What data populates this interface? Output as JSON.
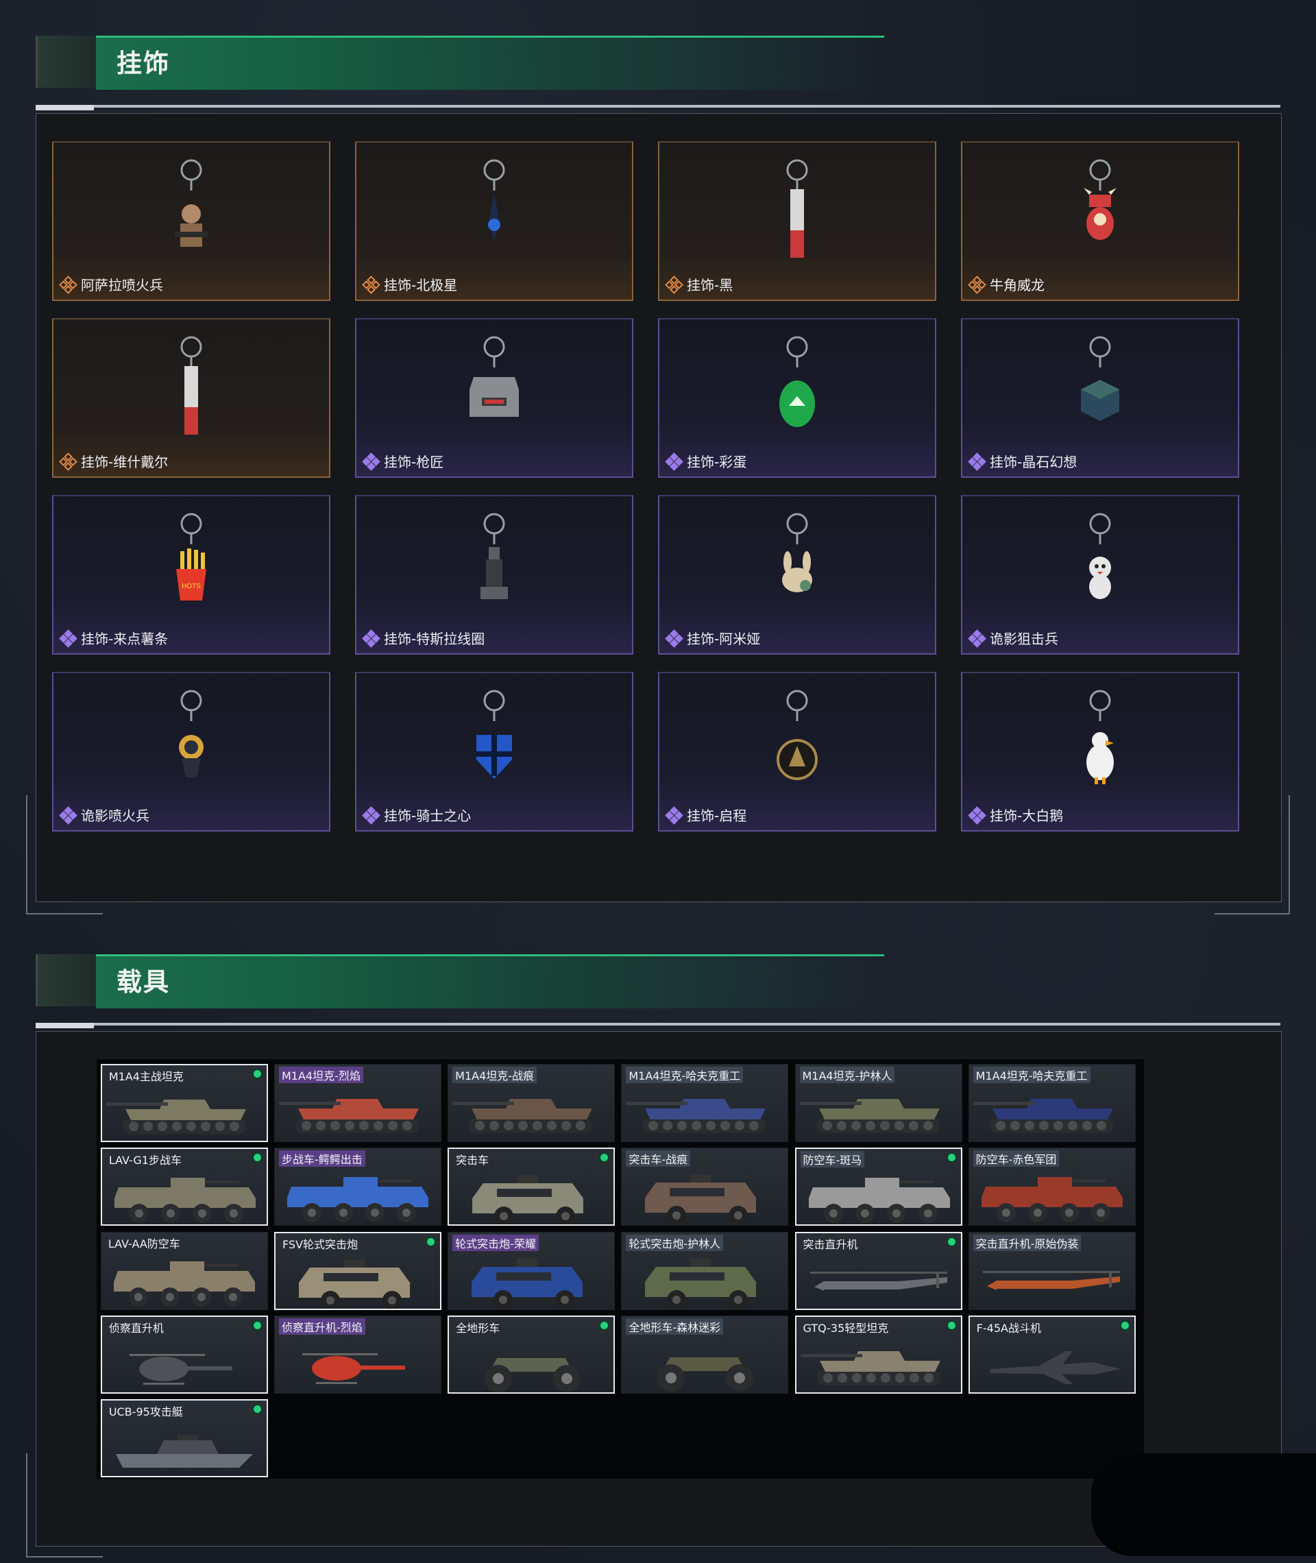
{
  "sections": {
    "charms": {
      "title": "挂饰"
    },
    "vehicles": {
      "title": "载具"
    }
  },
  "charms": [
    {
      "label": "阿萨拉喷火兵",
      "rarity": "gold",
      "icon": "soldier-charm-icon",
      "color": "#8a6a4a"
    },
    {
      "label": "挂饰-北极星",
      "rarity": "gold",
      "icon": "north-star-charm-icon",
      "color": "#2b6ad8"
    },
    {
      "label": "挂饰-黑",
      "rarity": "gold",
      "icon": "blade-charm-icon",
      "color": "#c93a3a"
    },
    {
      "label": "牛角威龙",
      "rarity": "gold",
      "icon": "horn-dragon-charm-icon",
      "color": "#d23d3d"
    },
    {
      "label": "挂饰-维什戴尔",
      "rarity": "gold",
      "icon": "blade-charm-icon",
      "color": "#c93a3a"
    },
    {
      "label": "挂饰-枪匠",
      "rarity": "purple",
      "icon": "gunsmith-case-charm-icon",
      "color": "#8a8c90"
    },
    {
      "label": "挂饰-彩蛋",
      "rarity": "purple",
      "icon": "egg-charm-icon",
      "color": "#1ea84a"
    },
    {
      "label": "挂饰-晶石幻想",
      "rarity": "purple",
      "icon": "crystal-cube-charm-icon",
      "color": "#2c4a5e"
    },
    {
      "label": "挂饰-来点薯条",
      "rarity": "purple",
      "icon": "fries-charm-icon",
      "color": "#e53a2a"
    },
    {
      "label": "挂饰-特斯拉线圈",
      "rarity": "purple",
      "icon": "tesla-coil-charm-icon",
      "color": "#5b5e63"
    },
    {
      "label": "挂饰-阿米娅",
      "rarity": "purple",
      "icon": "bunny-charm-icon",
      "color": "#d9c9a8"
    },
    {
      "label": "诡影狙击兵",
      "rarity": "purple",
      "icon": "sniper-charm-icon",
      "color": "#e6e6e6"
    },
    {
      "label": "诡影喷火兵",
      "rarity": "purple",
      "icon": "flamer-charm-icon",
      "color": "#d8a43a"
    },
    {
      "label": "挂饰-骑士之心",
      "rarity": "purple",
      "icon": "knight-heart-charm-icon",
      "color": "#2457c8"
    },
    {
      "label": "挂饰-启程",
      "rarity": "purple",
      "icon": "medal-charm-icon",
      "color": "#a88a4a"
    },
    {
      "label": "挂饰-大白鹅",
      "rarity": "purple",
      "icon": "goose-charm-icon",
      "color": "#f0f0f0"
    }
  ],
  "vehicles": [
    {
      "label": "M1A4主战坦克",
      "tag": "none",
      "owned": true,
      "type": "tank",
      "color": "#7d7a62"
    },
    {
      "label": "M1A4坦克-烈焰",
      "tag": "purple",
      "owned": false,
      "type": "tank",
      "color": "#b24a3a"
    },
    {
      "label": "M1A4坦克-战痕",
      "tag": "gray",
      "owned": false,
      "type": "tank",
      "color": "#6a5648"
    },
    {
      "label": "M1A4坦克-哈夫克重工",
      "tag": "gray",
      "owned": false,
      "type": "tank",
      "color": "#3a4a8a"
    },
    {
      "label": "M1A4坦克-护林人",
      "tag": "gray",
      "owned": false,
      "type": "tank",
      "color": "#6a6e52"
    },
    {
      "label": "M1A4坦克-哈夫克重工",
      "tag": "gray",
      "owned": false,
      "type": "tank",
      "color": "#2c3a7a"
    },
    {
      "label": "LAV-G1步战车",
      "tag": "none",
      "owned": true,
      "type": "ifv",
      "color": "#7c7a66"
    },
    {
      "label": "步战车-鳄鳄出击",
      "tag": "purple",
      "owned": false,
      "type": "ifv",
      "color": "#3a6ac8"
    },
    {
      "label": "突击车",
      "tag": "none",
      "owned": true,
      "type": "mrap",
      "color": "#8a8a78"
    },
    {
      "label": "突击车-战痕",
      "tag": "gray",
      "owned": false,
      "type": "mrap",
      "color": "#6e5a4e"
    },
    {
      "label": "防空车-斑马",
      "tag": "gray",
      "owned": true,
      "type": "ifv",
      "color": "#9a9a9a"
    },
    {
      "label": "防空车-赤色军团",
      "tag": "gray",
      "owned": false,
      "type": "ifv",
      "color": "#9a3a2a"
    },
    {
      "label": "LAV-AA防空车",
      "tag": "none",
      "owned": false,
      "type": "ifv",
      "color": "#8a806a"
    },
    {
      "label": "FSV轮式突击炮",
      "tag": "none",
      "owned": true,
      "type": "mrap",
      "color": "#9a9078"
    },
    {
      "label": "轮式突击炮-荣耀",
      "tag": "purple",
      "owned": false,
      "type": "mrap",
      "color": "#2a4a9a"
    },
    {
      "label": "轮式突击炮-护林人",
      "tag": "gray",
      "owned": false,
      "type": "mrap",
      "color": "#5e6a4a"
    },
    {
      "label": "突击直升机",
      "tag": "none",
      "owned": true,
      "type": "heli",
      "color": "#6a6e72"
    },
    {
      "label": "突击直升机-原始伪装",
      "tag": "gray",
      "owned": false,
      "type": "heli",
      "color": "#b8552a"
    },
    {
      "label": "侦察直升机",
      "tag": "none",
      "owned": true,
      "type": "scout",
      "color": "#4e5256"
    },
    {
      "label": "侦察直升机-烈焰",
      "tag": "purple",
      "owned": false,
      "type": "scout",
      "color": "#c83a2a"
    },
    {
      "label": "全地形车",
      "tag": "none",
      "owned": true,
      "type": "atv",
      "color": "#5e6250"
    },
    {
      "label": "全地形车-森林迷彩",
      "tag": "gray",
      "owned": false,
      "type": "atv",
      "color": "#5a5a44"
    },
    {
      "label": "GTQ-35轻型坦克",
      "tag": "none",
      "owned": true,
      "type": "tank",
      "color": "#8a8270"
    },
    {
      "label": "F-45A战斗机",
      "tag": "none",
      "owned": true,
      "type": "jet",
      "color": "#3e4248"
    },
    {
      "label": "UCB-95攻击艇",
      "tag": "none",
      "owned": true,
      "type": "boat",
      "color": "#6a7078"
    }
  ]
}
